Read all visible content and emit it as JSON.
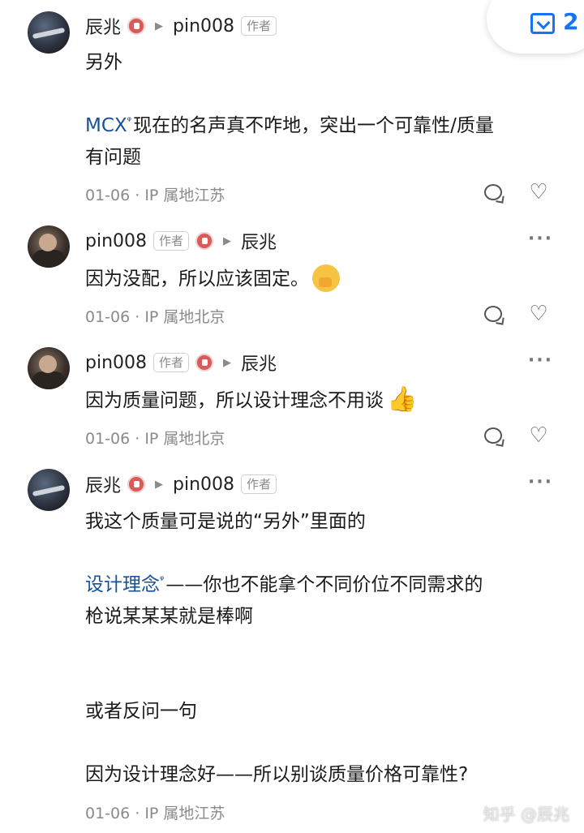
{
  "favorite": {
    "icon": "collection-icon",
    "count": "2"
  },
  "comments": [
    {
      "user": "辰兆",
      "reply_to": "pin008",
      "reply_to_tag": "作者",
      "author_tag": "",
      "lines": [
        "另外"
      ],
      "link": "MCX",
      "rest1": "现在的名声真不咋地，突出一个可靠性/质量",
      "rest2": "有问题",
      "meta": "01-06 · IP 属地江苏"
    },
    {
      "user": "pin008",
      "author_tag": "作者",
      "reply_to": "辰兆",
      "text": "因为没配，所以应该固定。",
      "meta": "01-06 · IP 属地北京"
    },
    {
      "user": "pin008",
      "author_tag": "作者",
      "reply_to": "辰兆",
      "text": "因为质量问题，所以设计理念不用谈",
      "meta": "01-06 · IP 属地北京"
    },
    {
      "user": "辰兆",
      "reply_to": "pin008",
      "reply_to_tag": "作者",
      "line1": "我这个质量可是说的“另外”里面的",
      "link": "设计理念",
      "rest1": "——你也不能拿个不同价位不同需求的",
      "rest2": "枪说某某某就是棒啊",
      "line3": "或者反问一句",
      "line4": "因为设计理念好——所以别谈质量价格可靠性?",
      "meta": "01-06 · IP 属地江苏"
    }
  ],
  "watermark": "知乎 @辰兆"
}
